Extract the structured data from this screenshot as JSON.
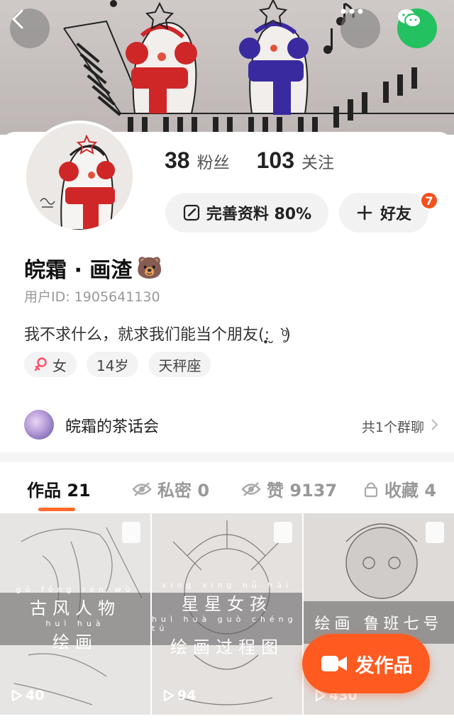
{
  "cover": {
    "icons": [
      "back-icon",
      "more-icon",
      "wechat-icon"
    ]
  },
  "profile": {
    "followers_count": "38",
    "followers_label": "粉丝",
    "following_count": "103",
    "following_label": "关注",
    "edit_profile_label": "完善资料 80%",
    "add_friend_label": "好友",
    "friend_badge": "7",
    "name": "皖霜 · 画渣",
    "name_emoji": "🐻",
    "user_id": "用户ID: 1905641130",
    "bio": "我不求什么，就求我们能当个朋友(:̣̣̥ ̮ ˋ̥ͦ)",
    "gender": "女",
    "age": "14岁",
    "zodiac": "天秤座"
  },
  "group": {
    "name": "皖霜的茶话会",
    "count_label": "共1个群聊"
  },
  "tabs": [
    {
      "label": "作品 21",
      "active": true
    },
    {
      "label": "私密 0",
      "active": false
    },
    {
      "label": "赞 9137",
      "active": false
    },
    {
      "label": "收藏 4",
      "active": false
    }
  ],
  "works": [
    {
      "pinyin": "gǔ fēng rén wù",
      "line1": "古风人物",
      "pinyin2": "huì huà",
      "line2": "绘画",
      "plays": "40"
    },
    {
      "pinyin": "xīng xīng nǚ hái",
      "line1": "星星女孩",
      "pinyin2": "huì huà guò chéng tú",
      "line2": "绘画过程图",
      "plays": "94"
    },
    {
      "pinyin": "",
      "line1": "绘画 鲁班七号",
      "pinyin2": "",
      "line2": "",
      "plays": "430"
    }
  ],
  "publish_label": "发作品",
  "colors": {
    "accent": "#ff5a1f",
    "badge": "#f4511e",
    "wechat": "#23c160"
  }
}
